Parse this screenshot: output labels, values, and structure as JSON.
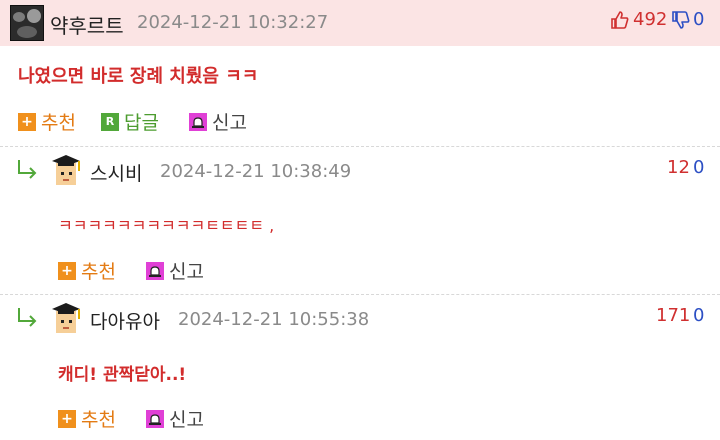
{
  "main_comment": {
    "username": "약후르트",
    "timestamp": "2024-12-21 10:32:27",
    "upvotes": "492",
    "downvotes": "0",
    "body": "나였으면 바로 장례 치뤘음 ㅋㅋ",
    "actions": {
      "recommend": "추천",
      "reply": "답글",
      "report": "신고"
    }
  },
  "replies": [
    {
      "username": "스시비",
      "timestamp": "2024-12-21 10:38:49",
      "upvotes": "12",
      "downvotes": "0",
      "body": "ㅋㅋㅋㅋㅋㅋㅋㅋㅋㅋㅌㅌㅌㅌ ,",
      "actions": {
        "recommend": "추천",
        "report": "신고"
      }
    },
    {
      "username": "다아유아",
      "timestamp": "2024-12-21 10:55:38",
      "upvotes": "171",
      "downvotes": "0",
      "body": "캐디! 관짝닫아..!",
      "actions": {
        "recommend": "추천",
        "report": "신고"
      }
    }
  ],
  "icons": {
    "thumbs_up": "thumbs-up-icon",
    "thumbs_down": "thumbs-down-icon",
    "recommend": "plus-icon",
    "reply": "reply-r-icon",
    "report": "siren-icon",
    "reply_arrow": "reply-arrow-icon"
  },
  "colors": {
    "header_bg": "#fbe4e4",
    "body_text": "#d22c2c",
    "upvote": "#d03030",
    "downvote": "#2c4fc4",
    "recommend": "#e37b14",
    "reply": "#4c9c2f",
    "report_icon": "#e040d6"
  }
}
